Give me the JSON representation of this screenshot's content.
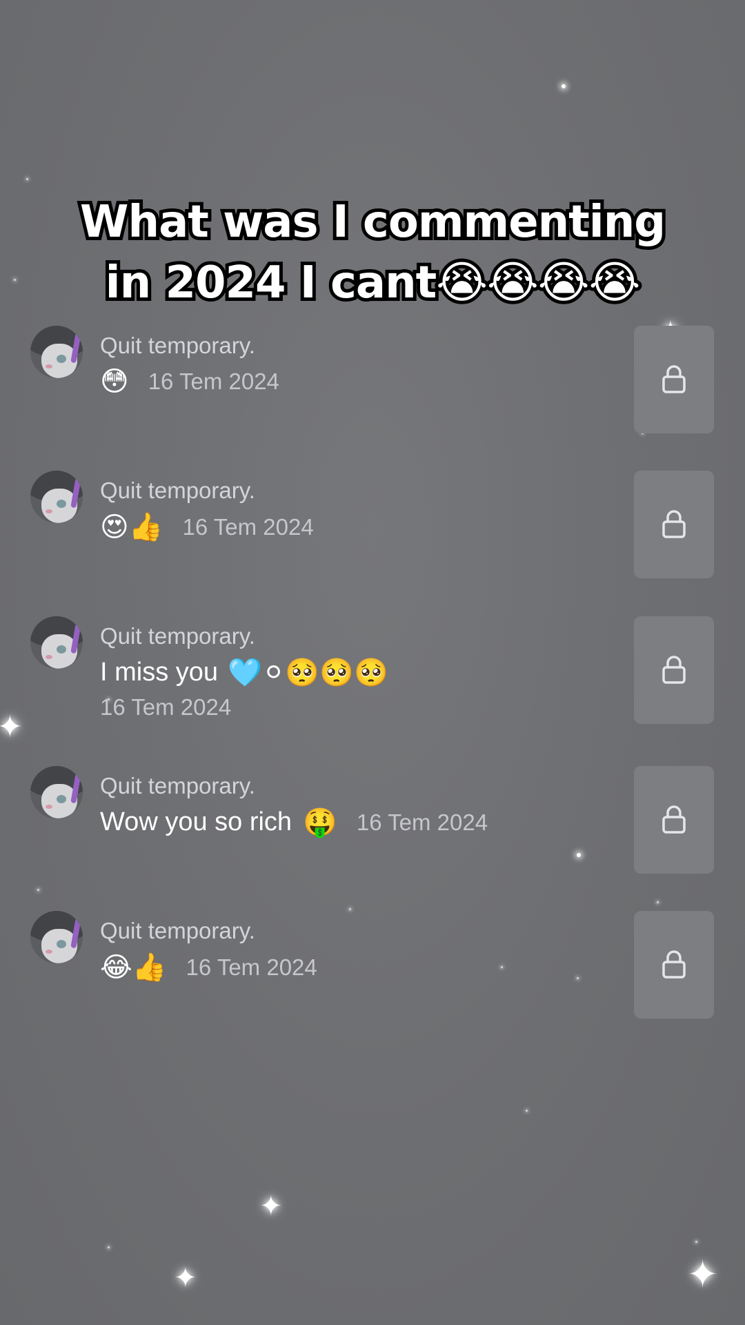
{
  "overlay_caption": {
    "line1": "What was I commenting",
    "line2": "in 2024 I cant😭😭😭😭"
  },
  "comments": [
    {
      "username": "Quit temporary.",
      "text": "",
      "emojis": "😳",
      "date": "16 Tem 2024"
    },
    {
      "username": "Quit temporary.",
      "text": "",
      "emojis": "😍👍",
      "date": "16 Tem 2024"
    },
    {
      "username": "Quit temporary.",
      "text": "I miss you",
      "emojis": "🩵⚪🥺🥺🥺",
      "date": "16 Tem 2024"
    },
    {
      "username": "Quit temporary.",
      "text": "Wow you so rich",
      "emojis": "🤑",
      "date": "16 Tem 2024"
    },
    {
      "username": "Quit temporary.",
      "text": "",
      "emojis": "😂👍",
      "date": "16 Tem 2024"
    }
  ],
  "icons": {
    "avatar": "avatar-icon",
    "thumbnail": "lock-icon"
  },
  "colors": {
    "background": "#6e6f72",
    "thumbnail": "#7d7e82",
    "avatar_accent": "#9b5fd0"
  }
}
